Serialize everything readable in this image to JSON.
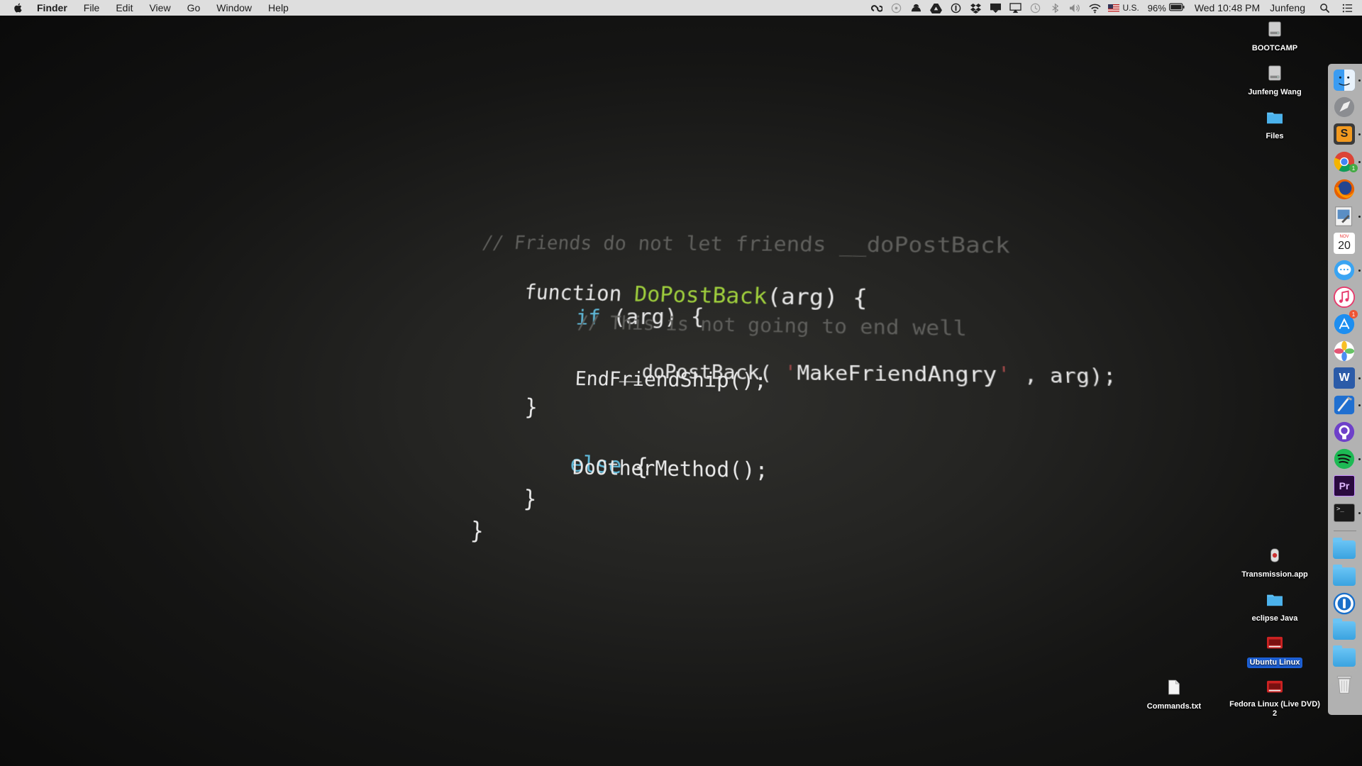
{
  "menubar": {
    "app_name": "Finder",
    "menus": [
      "File",
      "Edit",
      "View",
      "Go",
      "Window",
      "Help"
    ],
    "input_source": "U.S.",
    "battery": "96%",
    "clock": "Wed 10:48 PM",
    "user": "Junfeng",
    "status_icons": [
      "creative-cloud-icon",
      "disk-icon",
      "alfred-icon",
      "google-drive-icon",
      "1password-icon",
      "dropbox-icon",
      "notification-icon",
      "airplay-icon",
      "time-machine-icon",
      "bluetooth-icon",
      "volume-icon",
      "wifi-icon"
    ]
  },
  "wallpaper": {
    "lines": {
      "l1": "// Friends do not let friends __doPostBack",
      "l2a": "function ",
      "l2b": "DoPostBack",
      "l2c": "(arg) {",
      "l3a": "if",
      "l3b": " (arg) {",
      "l4": "// This is not going to end well",
      "l5a": "__doPostBack( ",
      "l5b": "'",
      "l5c": "MakeFriendAngry",
      "l5d": "'",
      "l5e": " , arg);",
      "l6": "EndFriendShip();",
      "l7": "}",
      "l8a": "else",
      "l8b": " {",
      "l9": "DoOtherMethod();",
      "l10": "}",
      "l11": "}"
    }
  },
  "desktop": {
    "icons": [
      {
        "label": "BOOTCAMP"
      },
      {
        "label": "Junfeng Wang"
      },
      {
        "label": "Files"
      },
      {
        "label": "Transmission.app"
      },
      {
        "label": "eclipse Java"
      },
      {
        "label": "Ubuntu Linux"
      },
      {
        "label": "Commands.txt"
      },
      {
        "label": "Fedora Linux (Live DVD)\n2"
      }
    ]
  },
  "dock": {
    "calendar_day": "20",
    "calendar_month": "NOV",
    "appstore_badge": "1",
    "chrome_badge": "1",
    "word_letter": "W",
    "premiere_letters": "Pr",
    "sublime_letter": "S",
    "terminal_prompt": ">_",
    "apps": [
      "Finder",
      "Launchpad",
      "Sublime Text",
      "Google Chrome",
      "Firefox",
      "Preview",
      "Calendar",
      "Messages",
      "iTunes",
      "App Store",
      "Photos",
      "Microsoft Word",
      "Xcode",
      "GitHub Desktop",
      "Spotify",
      "Adobe Premiere Pro",
      "Terminal",
      "Folder",
      "Folder",
      "1Password",
      "Folder",
      "Folder",
      "Trash"
    ]
  },
  "colors": {
    "menubar_bg": "#dedede",
    "comment": "#5f5f5c",
    "keyword_blue": "#5fb8d8",
    "function_green": "#9fcf3c",
    "selection": "#1c5fd4"
  }
}
